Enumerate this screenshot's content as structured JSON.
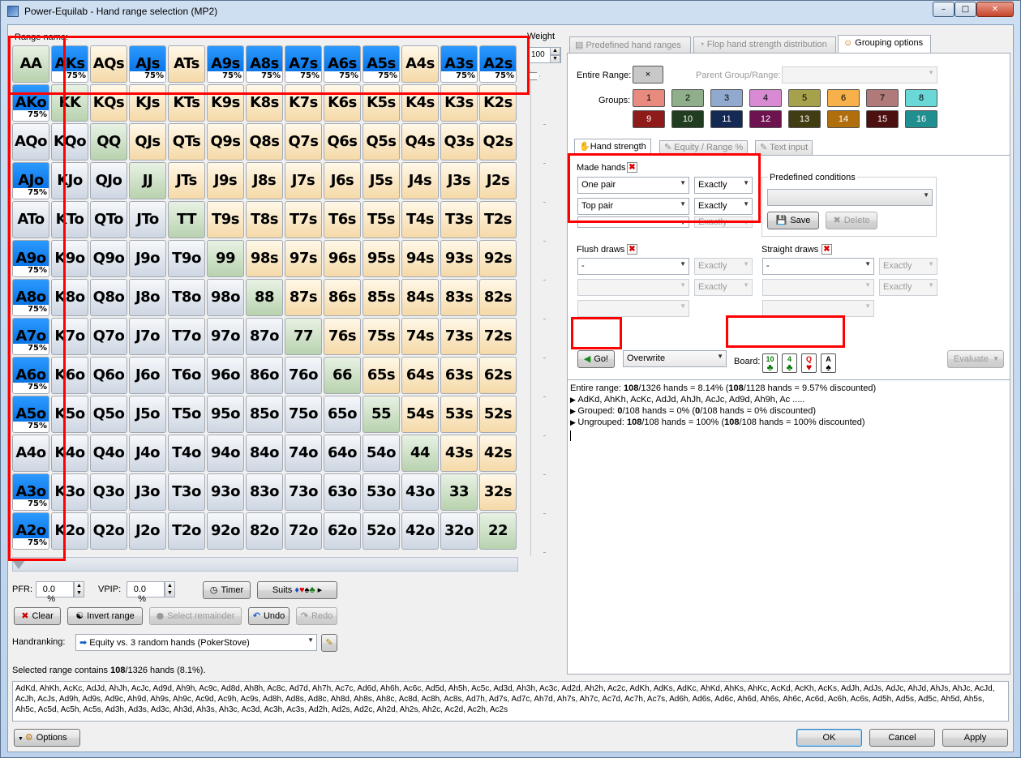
{
  "window": {
    "title": "Power-Equilab - Hand range selection (MP2)",
    "minimize": "–",
    "maximize": "□",
    "close": "✕"
  },
  "range_name_label": "Range name:",
  "weight": {
    "label": "Weight",
    "value": "100"
  },
  "grid": {
    "rows": [
      [
        "AA",
        "AKs",
        "AQs",
        "AJs",
        "ATs",
        "A9s",
        "A8s",
        "A7s",
        "A6s",
        "A5s",
        "A4s",
        "A3s",
        "A2s"
      ],
      [
        "AKo",
        "KK",
        "KQs",
        "KJs",
        "KTs",
        "K9s",
        "K8s",
        "K7s",
        "K6s",
        "K5s",
        "K4s",
        "K3s",
        "K2s"
      ],
      [
        "AQo",
        "KQo",
        "QQ",
        "QJs",
        "QTs",
        "Q9s",
        "Q8s",
        "Q7s",
        "Q6s",
        "Q5s",
        "Q4s",
        "Q3s",
        "Q2s"
      ],
      [
        "AJo",
        "KJo",
        "QJo",
        "JJ",
        "JTs",
        "J9s",
        "J8s",
        "J7s",
        "J6s",
        "J5s",
        "J4s",
        "J3s",
        "J2s"
      ],
      [
        "ATo",
        "KTo",
        "QTo",
        "JTo",
        "TT",
        "T9s",
        "T8s",
        "T7s",
        "T6s",
        "T5s",
        "T4s",
        "T3s",
        "T2s"
      ],
      [
        "A9o",
        "K9o",
        "Q9o",
        "J9o",
        "T9o",
        "99",
        "98s",
        "97s",
        "96s",
        "95s",
        "94s",
        "93s",
        "92s"
      ],
      [
        "A8o",
        "K8o",
        "Q8o",
        "J8o",
        "T8o",
        "98o",
        "88",
        "87s",
        "86s",
        "85s",
        "84s",
        "83s",
        "82s"
      ],
      [
        "A7o",
        "K7o",
        "Q7o",
        "J7o",
        "T7o",
        "97o",
        "87o",
        "77",
        "76s",
        "75s",
        "74s",
        "73s",
        "72s"
      ],
      [
        "A6o",
        "K6o",
        "Q6o",
        "J6o",
        "T6o",
        "96o",
        "86o",
        "76o",
        "66",
        "65s",
        "64s",
        "63s",
        "62s"
      ],
      [
        "A5o",
        "K5o",
        "Q5o",
        "J5o",
        "T5o",
        "95o",
        "85o",
        "75o",
        "65o",
        "55",
        "54s",
        "53s",
        "52s"
      ],
      [
        "A4o",
        "K4o",
        "Q4o",
        "J4o",
        "T4o",
        "94o",
        "84o",
        "74o",
        "64o",
        "54o",
        "44",
        "43s",
        "42s"
      ],
      [
        "A3o",
        "K3o",
        "Q3o",
        "J3o",
        "T3o",
        "93o",
        "83o",
        "73o",
        "63o",
        "53o",
        "43o",
        "33",
        "32s"
      ],
      [
        "A2o",
        "K2o",
        "Q2o",
        "J2o",
        "T2o",
        "92o",
        "82o",
        "72o",
        "62o",
        "52o",
        "42o",
        "32o",
        "22"
      ]
    ],
    "weighted": {
      "AKs": "75%",
      "AJs": "75%",
      "A9s": "75%",
      "A8s": "75%",
      "A7s": "75%",
      "A6s": "75%",
      "A5s": "75%",
      "A3s": "75%",
      "A2s": "75%",
      "AKo": "75%",
      "AJo": "75%",
      "A9o": "75%",
      "A8o": "75%",
      "A7o": "75%",
      "A6o": "75%",
      "A5o": "75%",
      "A3o": "75%",
      "A2o": "75%"
    }
  },
  "pfr": {
    "label": "PFR:",
    "value": "0.0 %"
  },
  "vpip": {
    "label": "VPIP:",
    "value": "0.0 %"
  },
  "buttons": {
    "timer": "Timer",
    "suits": "Suits",
    "clear": "Clear",
    "invert": "Invert range",
    "select_remainder": "Select remainder",
    "undo": "Undo",
    "redo": "Redo",
    "options": "Options",
    "ok": "OK",
    "cancel": "Cancel",
    "apply": "Apply"
  },
  "handranking": {
    "label": "Handranking:",
    "value": "Equity vs. 3 random hands (PokerStove)"
  },
  "status": {
    "prefix": "Selected range contains ",
    "count": "108",
    "suffix": "/1326 hands (8.1%)."
  },
  "handlist": "AdKd, AhKh, AcKc, AdJd, AhJh, AcJc, Ad9d, Ah9h, Ac9c, Ad8d, Ah8h, Ac8c, Ad7d, Ah7h, Ac7c, Ad6d, Ah6h, Ac6c, Ad5d, Ah5h, Ac5c, Ad3d, Ah3h, Ac3c, Ad2d, Ah2h, Ac2c, AdKh, AdKs, AdKc, AhKd, AhKs, AhKc, AcKd, AcKh, AcKs, AdJh, AdJs, AdJc, AhJd, AhJs, AhJc, AcJd, AcJh, AcJs, Ad9h, Ad9s, Ad9c, Ah9d, Ah9s, Ah9c, Ac9d, Ac9h, Ac9s, Ad8h, Ad8s, Ad8c, Ah8d, Ah8s, Ah8c, Ac8d, Ac8h, Ac8s, Ad7h, Ad7s, Ad7c, Ah7d, Ah7s, Ah7c, Ac7d, Ac7h, Ac7s, Ad6h, Ad6s, Ad6c, Ah6d, Ah6s, Ah6c, Ac6d, Ac6h, Ac6s, Ad5h, Ad5s, Ad5c, Ah5d, Ah5s, Ah5c, Ac5d, Ac5h, Ac5s, Ad3h, Ad3s, Ad3c, Ah3d, Ah3s, Ah3c, Ac3d, Ac3h, Ac3s, Ad2h, Ad2s, Ad2c, Ah2d, Ah2s, Ah2c, Ac2d, Ac2h, Ac2s",
  "tabs": [
    "Predefined hand ranges",
    "Flop hand strength distribution",
    "Grouping options"
  ],
  "entire_range": {
    "label": "Entire Range:",
    "button": "×"
  },
  "parent_group": {
    "label": "Parent Group/Range:"
  },
  "groups": {
    "label": "Groups:",
    "items": [
      "1",
      "2",
      "3",
      "4",
      "5",
      "6",
      "7",
      "8",
      "9",
      "10",
      "11",
      "12",
      "13",
      "14",
      "15",
      "16"
    ],
    "colors": [
      "#e98a7e",
      "#8fae8a",
      "#91a9cf",
      "#d88ad2",
      "#a6a24c",
      "#f7b04a",
      "#b07a7a",
      "#6bd8d8",
      "#8e1a1a",
      "#213d21",
      "#142a55",
      "#6d1450",
      "#413c12",
      "#b06f0c",
      "#4c1010",
      "#1f8f8f"
    ]
  },
  "subtabs": [
    "Hand strength",
    "Equity / Range %",
    "Text input"
  ],
  "made_hands": {
    "label": "Made hands",
    "row1": "One pair",
    "row2": "Top pair",
    "row3": "-",
    "mode": "Exactly"
  },
  "predefined_conditions": {
    "label": "Predefined conditions",
    "save": "Save",
    "delete": "Delete"
  },
  "flush_draws": {
    "label": "Flush draws",
    "value": "-",
    "mode": "Exactly"
  },
  "straight_draws": {
    "label": "Straight draws",
    "value": "-",
    "mode": "Exactly"
  },
  "go": {
    "label": "Go!",
    "mode": "Overwrite"
  },
  "board": {
    "label": "Board:",
    "cards": [
      {
        "rank": "10",
        "suit": "♣",
        "color": "#0a7a0a"
      },
      {
        "rank": "4",
        "suit": "♣",
        "color": "#0a7a0a"
      },
      {
        "rank": "Q",
        "suit": "♥",
        "color": "#d40000"
      },
      {
        "rank": "A",
        "suit": "♠",
        "color": "#000000"
      }
    ]
  },
  "evaluate": "Evaluate",
  "results": {
    "line1a": "Entire range: ",
    "line1b": "108",
    "line1c": "/1326 hands = 8.14%  (",
    "line1d": "108",
    "line1e": "/1128 hands = 9.57% discounted)",
    "line2": "AdKd, AhKh, AcKc, AdJd, AhJh, AcJc, Ad9d, Ah9h, Ac .....",
    "line3a": "Grouped: ",
    "line3b": "0",
    "line3c": "/108 hands = 0%  (",
    "line3d": "0",
    "line3e": "/108 hands = 0% discounted)",
    "line4a": "Ungrouped: ",
    "line4b": "108",
    "line4c": "/108 hands = 100%  (",
    "line4d": "108",
    "line4e": "/108 hands = 100% discounted)"
  }
}
